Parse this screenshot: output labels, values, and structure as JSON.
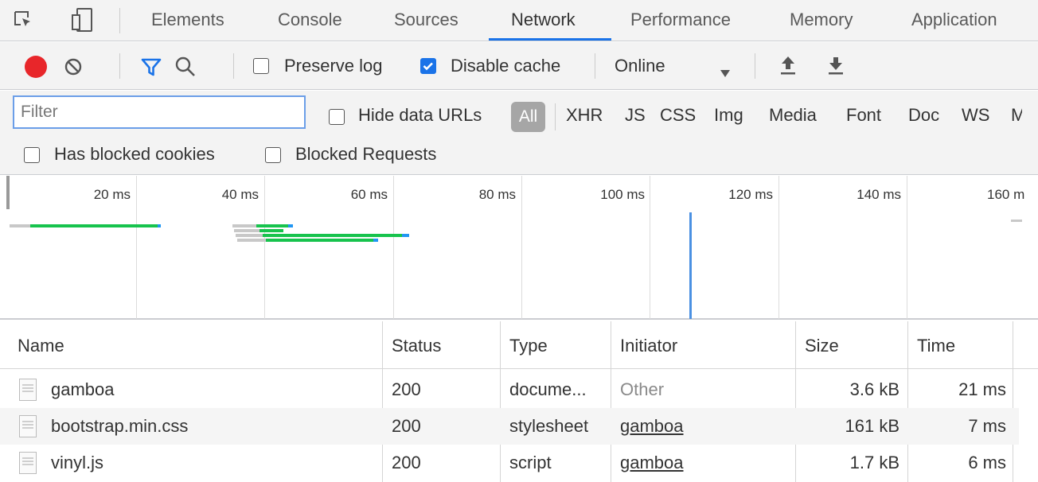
{
  "tabs": [
    {
      "label": "Elements"
    },
    {
      "label": "Console"
    },
    {
      "label": "Sources"
    },
    {
      "label": "Network",
      "active": true
    },
    {
      "label": "Performance"
    },
    {
      "label": "Memory"
    },
    {
      "label": "Application"
    }
  ],
  "toolbar": {
    "preserve_log_label": "Preserve log",
    "preserve_log_checked": false,
    "disable_cache_label": "Disable cache",
    "disable_cache_checked": true,
    "throttling_value": "Online",
    "record_color": "#e8262a",
    "accent_color": "#1a73e8"
  },
  "filter": {
    "placeholder": "Filter",
    "hide_data_urls_label": "Hide data URLs",
    "types": [
      "All",
      "XHR",
      "JS",
      "CSS",
      "Img",
      "Media",
      "Font",
      "Doc",
      "WS",
      "M"
    ],
    "active_type": "All",
    "has_blocked_cookies_label": "Has blocked cookies",
    "blocked_requests_label": "Blocked Requests"
  },
  "overview": {
    "ticks": [
      "20 ms",
      "40 ms",
      "60 ms",
      "80 ms",
      "100 ms",
      "120 ms",
      "140 ms",
      "160 m"
    ]
  },
  "table": {
    "columns": [
      "Name",
      "Status",
      "Type",
      "Initiator",
      "Size",
      "Time"
    ],
    "rows": [
      {
        "name": "gamboa",
        "status": "200",
        "type": "docume...",
        "initiator": "Other",
        "initiator_link": false,
        "size": "3.6 kB",
        "time": "21 ms"
      },
      {
        "name": "bootstrap.min.css",
        "status": "200",
        "type": "stylesheet",
        "initiator": "gamboa",
        "initiator_link": true,
        "size": "161 kB",
        "time": "7 ms"
      },
      {
        "name": "vinyl.js",
        "status": "200",
        "type": "script",
        "initiator": "gamboa",
        "initiator_link": true,
        "size": "1.7 kB",
        "time": "6 ms"
      }
    ]
  },
  "icons": [
    "inspect-element-icon",
    "device-toolbar-icon",
    "record-icon",
    "clear-icon",
    "filter-icon",
    "search-icon",
    "dropdown-arrow-icon",
    "import-har-icon",
    "export-har-icon",
    "file-icon"
  ]
}
